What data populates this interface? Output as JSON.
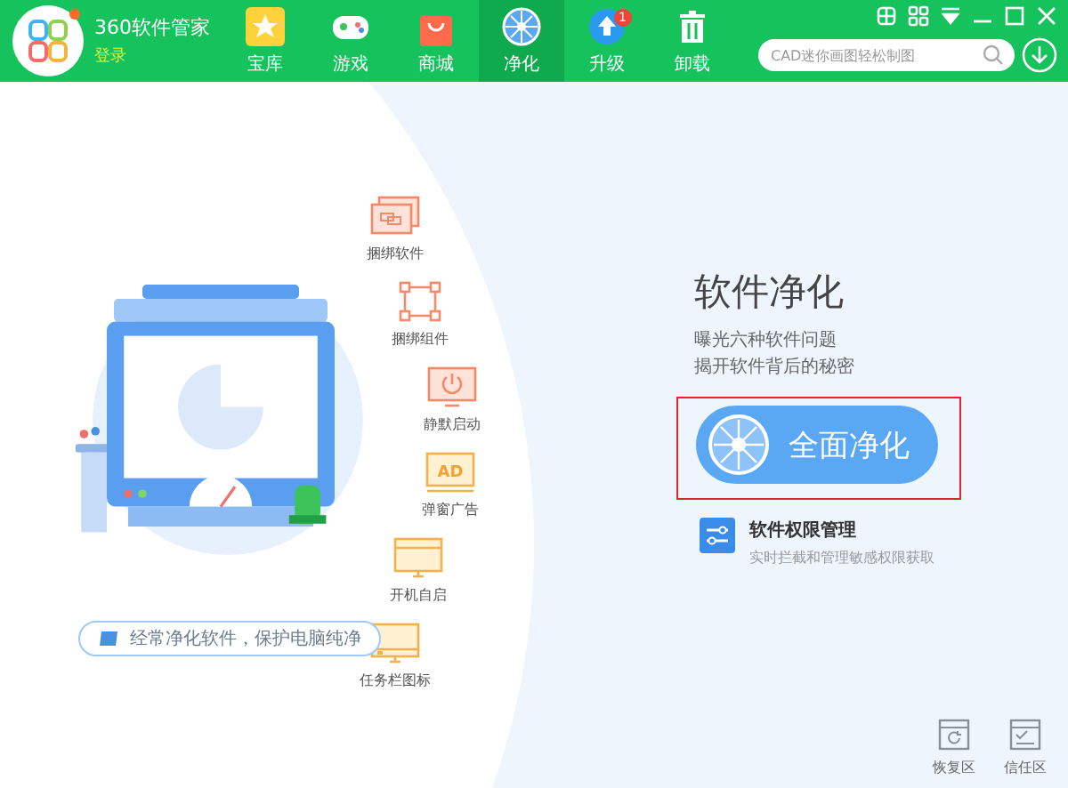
{
  "app": {
    "title": "360软件管家",
    "login": "登录"
  },
  "tabs": [
    {
      "label": "宝库",
      "selected": false
    },
    {
      "label": "游戏",
      "selected": false
    },
    {
      "label": "商城",
      "selected": false
    },
    {
      "label": "净化",
      "selected": true
    },
    {
      "label": "升级",
      "selected": false,
      "badge": "1"
    },
    {
      "label": "卸载",
      "selected": false
    }
  ],
  "search": {
    "placeholder": "CAD迷你画图轻松制图"
  },
  "features": [
    {
      "label": "捆绑软件"
    },
    {
      "label": "捆绑组件"
    },
    {
      "label": "静默启动"
    },
    {
      "label": "弹窗广告",
      "icon_text": "AD"
    },
    {
      "label": "开机自启"
    },
    {
      "label": "任务栏图标"
    }
  ],
  "tip": "经常净化软件，保护电脑纯净",
  "panel": {
    "title": "软件净化",
    "lines": [
      "曝光六种软件问题",
      "揭开软件背后的秘密"
    ],
    "button": "全面净化",
    "highlighted": true
  },
  "permission": {
    "title": "软件权限管理",
    "subtitle": "实时拦截和管理敏感权限获取"
  },
  "bottom_links": [
    {
      "label": "恢复区"
    },
    {
      "label": "信任区"
    }
  ]
}
